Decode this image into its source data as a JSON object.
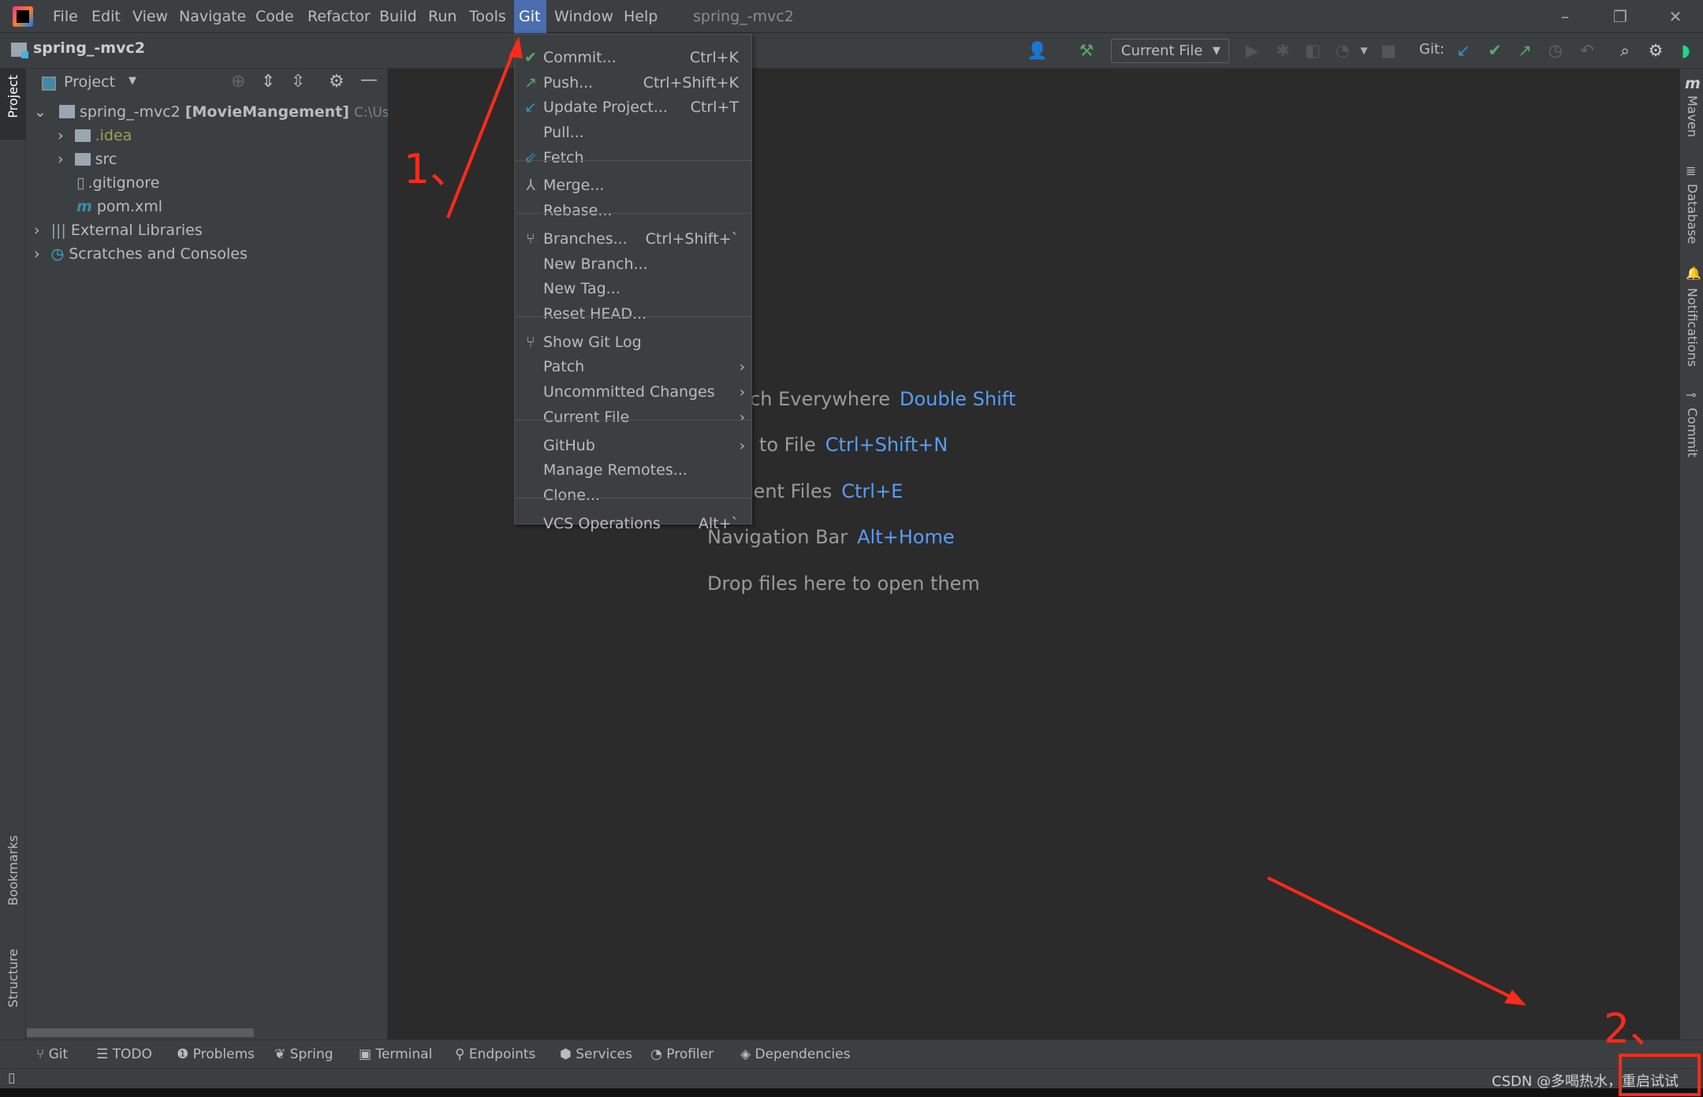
{
  "menubar": {
    "items": [
      "File",
      "Edit",
      "View",
      "Navigate",
      "Code",
      "Refactor",
      "Build",
      "Run",
      "Tools",
      "Git",
      "Window",
      "Help"
    ],
    "active": "Git",
    "window_title": "spring_-mvc2"
  },
  "window_controls": {
    "minimize": "–",
    "restore": "❐",
    "close": "✕"
  },
  "toolbar": {
    "project_name": "spring_-mvc2",
    "run_config": "Current File",
    "git_label": "Git:"
  },
  "left_strip": {
    "tabs": [
      "Project",
      "Bookmarks",
      "Structure"
    ]
  },
  "right_strip": {
    "tabs": [
      "Maven",
      "Database",
      "Notifications",
      "Commit"
    ]
  },
  "project_panel": {
    "title": "Project",
    "tree": [
      {
        "label": "spring_-mvc2",
        "module": "[MovieMangement]",
        "path": "C:\\Users\\",
        "icon": "module-folder-icon",
        "expanded": true
      },
      {
        "label": ".idea",
        "icon": "folder-icon",
        "color": "#a0a04a"
      },
      {
        "label": "src",
        "icon": "folder-icon"
      },
      {
        "label": ".gitignore",
        "icon": "ignore-file-icon"
      },
      {
        "label": "pom.xml",
        "icon": "maven-icon"
      },
      {
        "label": "External Libraries",
        "icon": "library-icon"
      },
      {
        "label": "Scratches and Consoles",
        "icon": "scratches-icon"
      }
    ]
  },
  "editor_hints": [
    {
      "text": "Search Everywhere",
      "key": "Double Shift"
    },
    {
      "text": "Go to File",
      "key": "Ctrl+Shift+N"
    },
    {
      "text": "Recent Files",
      "key": "Ctrl+E"
    },
    {
      "text": "Navigation Bar",
      "key": "Alt+Home"
    },
    {
      "text": "Drop files here to open them",
      "key": ""
    }
  ],
  "git_menu": {
    "items": [
      {
        "label": "Commit...",
        "shortcut": "Ctrl+K",
        "icon": "check-icon"
      },
      {
        "label": "Push...",
        "shortcut": "Ctrl+Shift+K",
        "icon": "push-arrow-icon"
      },
      {
        "label": "Update Project...",
        "shortcut": "Ctrl+T",
        "icon": "update-arrow-icon"
      },
      {
        "label": "Pull...",
        "shortcut": ""
      },
      {
        "label": "Fetch",
        "shortcut": "",
        "icon": "fetch-icon"
      },
      {
        "label": "Merge...",
        "shortcut": "",
        "icon": "merge-icon"
      },
      {
        "label": "Rebase...",
        "shortcut": ""
      },
      {
        "label": "Branches...",
        "shortcut": "Ctrl+Shift+`",
        "icon": "branch-icon"
      },
      {
        "label": "New Branch...",
        "shortcut": ""
      },
      {
        "label": "New Tag...",
        "shortcut": ""
      },
      {
        "label": "Reset HEAD...",
        "shortcut": ""
      },
      {
        "label": "Show Git Log",
        "shortcut": "",
        "icon": "git-log-icon"
      },
      {
        "label": "Patch",
        "submenu": true
      },
      {
        "label": "Uncommitted Changes",
        "submenu": true
      },
      {
        "label": "Current File",
        "submenu": true
      },
      {
        "label": "GitHub",
        "submenu": true
      },
      {
        "label": "Manage Remotes...",
        "shortcut": ""
      },
      {
        "label": "Clone...",
        "shortcut": ""
      },
      {
        "label": "VCS Operations",
        "shortcut": "Alt+`"
      }
    ]
  },
  "bottom_tabs": [
    "Git",
    "TODO",
    "Problems",
    "Spring",
    "Terminal",
    "Endpoints",
    "Services",
    "Profiler",
    "Dependencies"
  ],
  "annotations": {
    "step1": "1、",
    "step2": "2、",
    "color": "#ff2a1a"
  },
  "watermark": "CSDN @多喝热水，重启试试",
  "colors": {
    "accent": "#4b6eaf",
    "link": "#589df6",
    "background": "#3c3f41",
    "editor": "#2b2b2b"
  }
}
